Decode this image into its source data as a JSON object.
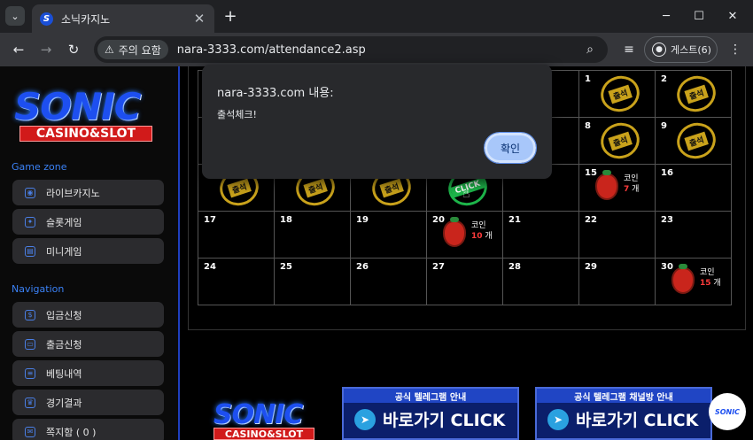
{
  "browser": {
    "tab_title": "소닉카지노",
    "favicon_letter": "S",
    "url": "nara-3333.com/attendance2.asp",
    "security_chip": "주의 요함",
    "profile_label": "게스트(6)"
  },
  "sidebar": {
    "logo_main": "SONIC",
    "logo_sub": "CASINO&SLOT",
    "sections": [
      {
        "title": "Game zone",
        "items": [
          "라이브카지노",
          "슬롯게임",
          "미니게임"
        ]
      },
      {
        "title": "Navigation",
        "items": [
          "입금신청",
          "출금신청",
          "베팅내역",
          "경기결과",
          "쪽지함 ( 0 )"
        ]
      }
    ]
  },
  "calendar": {
    "stamp_label": "출석",
    "click_label": "CLICK",
    "coin_label": "코인",
    "count_unit": "개",
    "rows": [
      [
        "",
        "",
        "",
        "",
        "",
        "1",
        "2"
      ],
      [
        "",
        "",
        "",
        "",
        "",
        "8",
        "9"
      ],
      [
        "",
        "",
        "",
        "",
        "",
        "15",
        "16"
      ],
      [
        "17",
        "18",
        "19",
        "20",
        "21",
        "22",
        "23"
      ],
      [
        "24",
        "25",
        "26",
        "27",
        "28",
        "29",
        "30"
      ]
    ],
    "stamped_days": [
      "1",
      "2",
      "8",
      "9"
    ],
    "coin_days": [
      {
        "day": "15",
        "count": "7"
      },
      {
        "day": "20",
        "count": "10"
      },
      {
        "day": "30",
        "count": "15"
      }
    ]
  },
  "banners": [
    {
      "head": "공식 텔레그램 안내",
      "cta": "바로가기 CLICK"
    },
    {
      "head": "공식 텔레그램 채널방 안내",
      "cta": "바로가기 CLICK"
    }
  ],
  "circle_logo": "SONIC",
  "dialog": {
    "title": "nara-3333.com 내용:",
    "message": "출석체크!",
    "ok_label": "확인"
  },
  "colors": {
    "accent_blue": "#1d4ff0",
    "stamp_gold": "#c9a21b",
    "click_green": "#1db54a",
    "coin_red": "#ff3b3b"
  }
}
